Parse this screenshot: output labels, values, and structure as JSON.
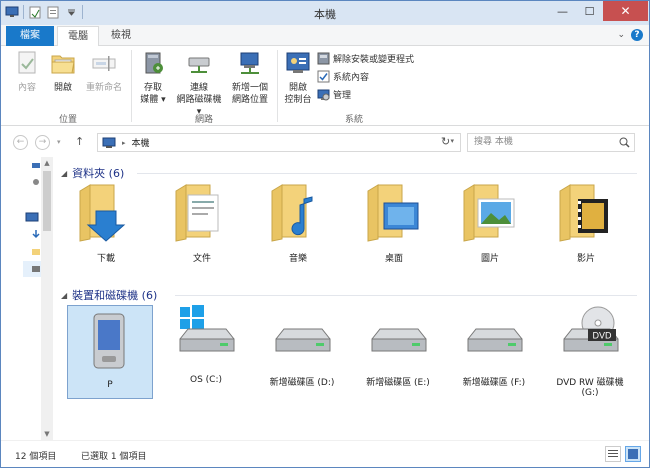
{
  "window": {
    "title": "本機"
  },
  "tabs": {
    "file": "檔案",
    "computer": "電腦",
    "view": "檢視"
  },
  "ribbon": {
    "location": {
      "label": "位置",
      "properties": "內容",
      "open": "開啟",
      "rename": "重新命名"
    },
    "network": {
      "label": "網路",
      "access_media": [
        "存取",
        "媒體"
      ],
      "map_drive": [
        "連線",
        "網路磁碟機"
      ],
      "add_location": [
        "新增一個",
        "網路位置"
      ]
    },
    "system": {
      "label": "系統",
      "control_panel": [
        "開啟",
        "控制台"
      ],
      "uninstall": "解除安裝或變更程式",
      "sys_properties": "系統內容",
      "manage": "管理"
    }
  },
  "address": {
    "path": "本機",
    "search_placeholder": "搜尋 本機"
  },
  "folders": {
    "header": "資料夾 (6)",
    "items": [
      "下載",
      "文件",
      "音樂",
      "桌面",
      "圖片",
      "影片"
    ]
  },
  "devices": {
    "header": "裝置和磁碟機 (6)",
    "items": [
      "P",
      "OS (C:)",
      "新增磁碟區 (D:)",
      "新增磁碟區 (E:)",
      "新增磁碟區 (F:)",
      "DVD RW 磁碟機 (G:)"
    ],
    "dvd_badge": "DVD"
  },
  "status": {
    "count": "12 個項目",
    "selected": "已選取 1 個項目"
  },
  "colors": {
    "accent": "#1979ca",
    "folder": "#f3d27a",
    "selection": "#cce4f7"
  }
}
